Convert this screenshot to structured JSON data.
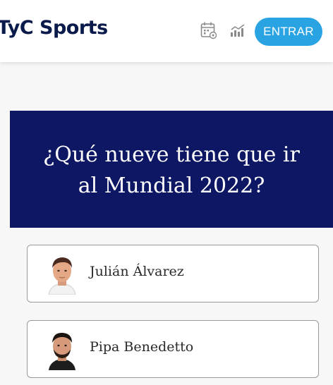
{
  "header": {
    "logo_text": "TyC Sports",
    "calendar_icon": "calendar-icon",
    "stats_icon": "stats-icon",
    "login_label": "ENTRAR"
  },
  "colors": {
    "brand_navy": "#0d1763",
    "accent_blue": "#2aa3e3"
  },
  "question": {
    "title": "¿Qué nueve tiene que ir al Mundial 2022?"
  },
  "options": [
    {
      "label": "Julián Álvarez"
    },
    {
      "label": "Pipa Benedetto"
    }
  ]
}
